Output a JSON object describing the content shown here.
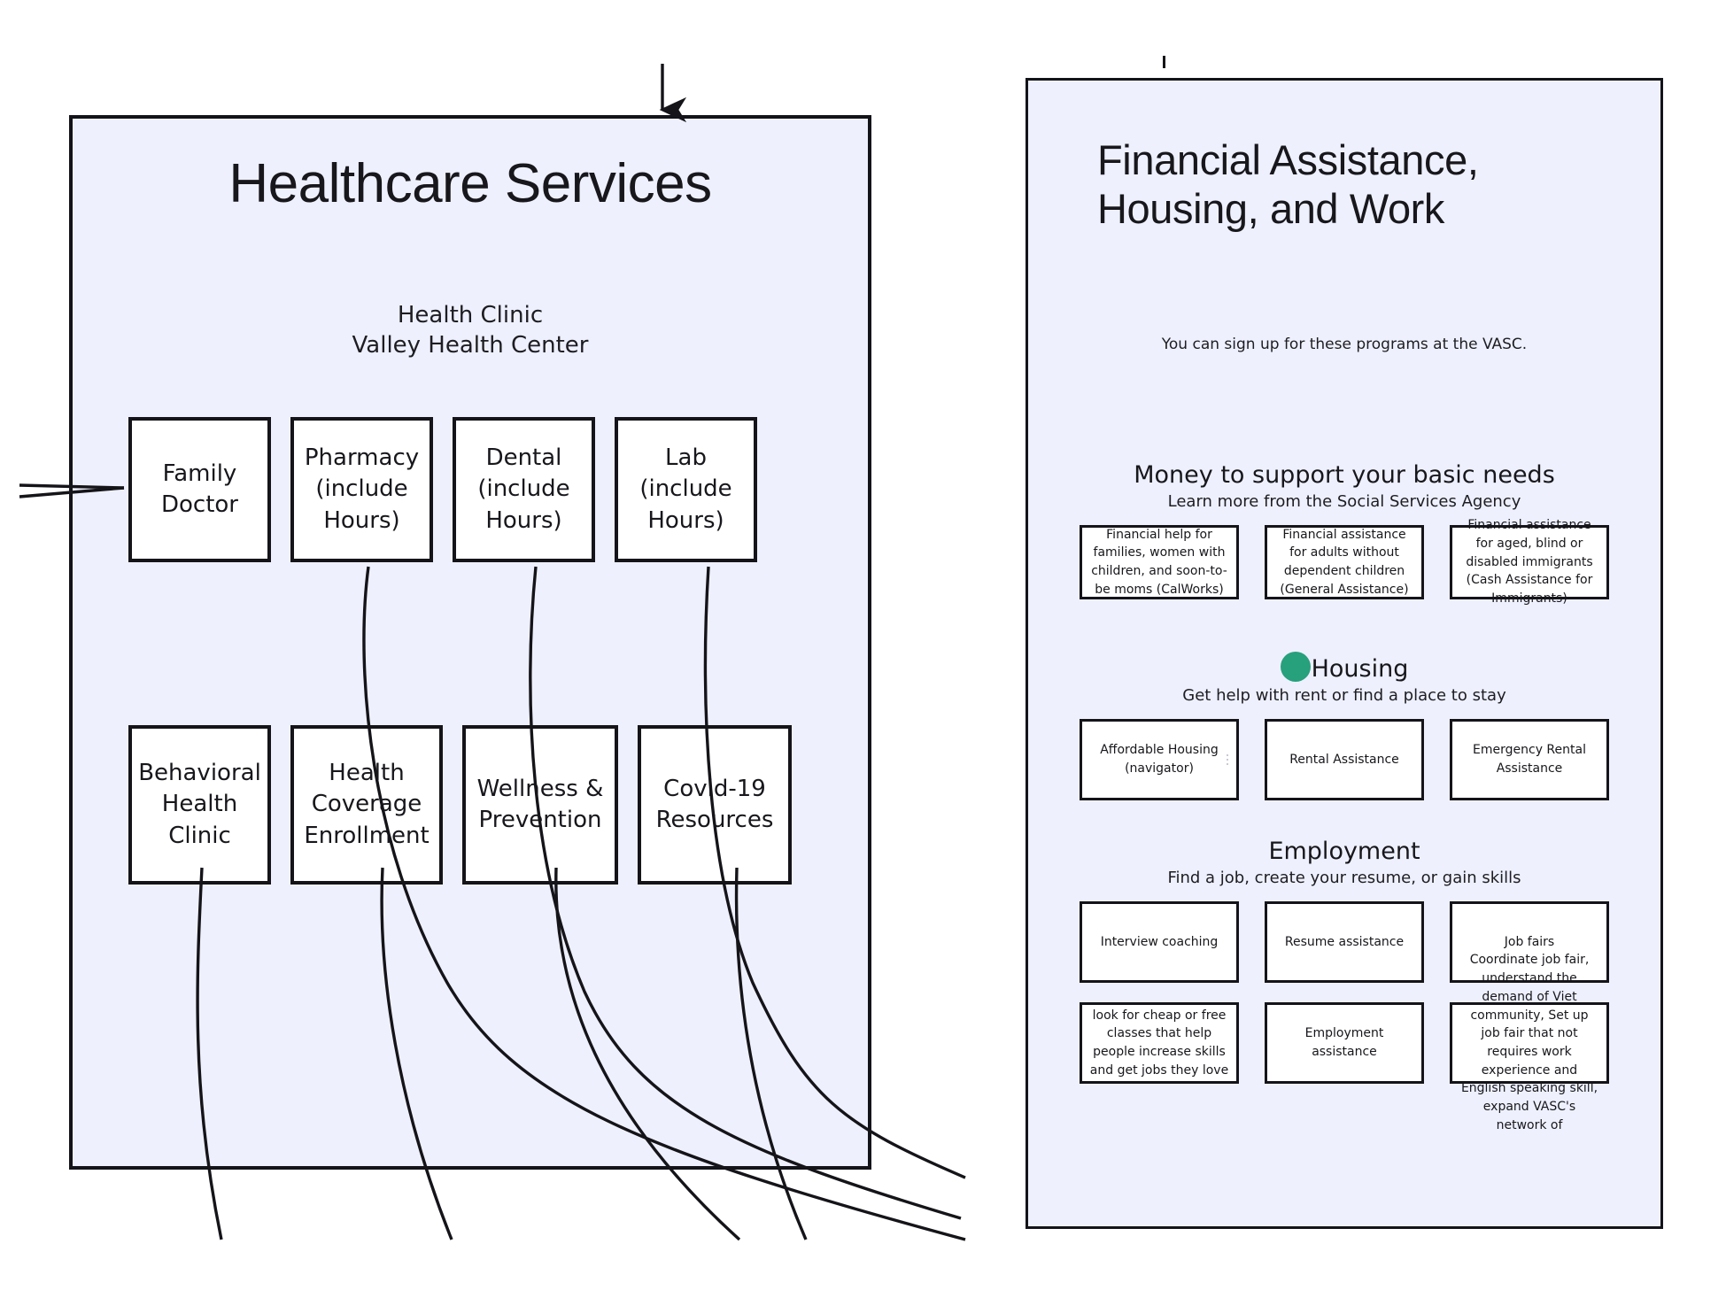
{
  "left_panel": {
    "title": "Healthcare Services",
    "subtitle_line1": "Health Clinic",
    "subtitle_line2": "Valley Health Center",
    "row1": [
      {
        "label": "Family Doctor"
      },
      {
        "label": "Pharmacy (include Hours)"
      },
      {
        "label": "Dental (include Hours)"
      },
      {
        "label": "Lab (include Hours)"
      }
    ],
    "row2": [
      {
        "label": "Behavioral Health Clinic"
      },
      {
        "label": "Health Coverage Enrollment"
      },
      {
        "label": "Wellness & Prevention"
      },
      {
        "label": "Covid-19 Resources"
      }
    ]
  },
  "right_panel": {
    "title": "Financial Assistance, Housing, and Work",
    "subtitle": "You can sign up for these programs at the VASC.",
    "sections": [
      {
        "id": "money",
        "heading": "Money to support your basic needs",
        "subheading": "Learn more from the Social Services Agency",
        "bullet_color": "",
        "cards": [
          {
            "label": "Financial help for families, women with children, and soon-to-be moms (CalWorks)"
          },
          {
            "label": "Financial assistance for adults without dependent children (General Assistance)"
          },
          {
            "label": "Financial assistance for aged, blind or disabled immigrants (Cash Assistance for Immigrants)"
          }
        ]
      },
      {
        "id": "housing",
        "heading": "Housing",
        "subheading": "Get help with rent or find a place to stay",
        "bullet_color": "#27a07c",
        "cards": [
          {
            "label": "Affordable Housing (navigator)"
          },
          {
            "label": "Rental Assistance"
          },
          {
            "label": "Emergency Rental Assistance"
          }
        ]
      },
      {
        "id": "employment",
        "heading": "Employment",
        "subheading": "Find a job, create your resume, or gain skills",
        "bullet_color": "",
        "cards": [
          {
            "label": "Interview coaching"
          },
          {
            "label": "Resume assistance"
          },
          {
            "label": "Job fairs"
          }
        ],
        "cards_row2": [
          {
            "label": "look for cheap or free classes that help people increase skills and get jobs they love"
          },
          {
            "label": "Employment assistance"
          },
          {
            "label": "Coordinate job fair, understand the demand of Viet community, Set up job fair that not requires work experience and English speaking skill, expand VASC's network of"
          }
        ]
      }
    ]
  },
  "style": {
    "panel_fill": "#eef0fd",
    "panel_border": "#13131a",
    "card_fill": "#ffffff",
    "accent_green": "#27a07c",
    "page_background": "#ffffff"
  }
}
